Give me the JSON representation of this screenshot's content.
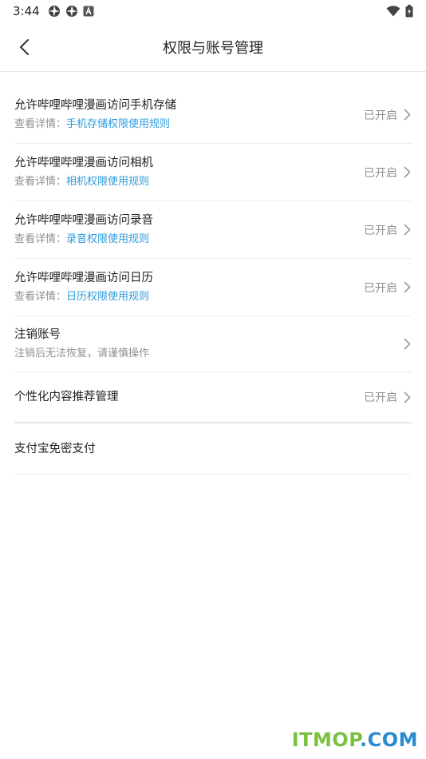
{
  "status_bar": {
    "time": "3:44",
    "left_icons": [
      "aperture-icon",
      "aperture-icon",
      "a-square-icon"
    ],
    "right_icons": [
      "wifi-icon",
      "battery-charging-icon"
    ]
  },
  "header": {
    "title": "权限与账号管理"
  },
  "rows": [
    {
      "title": "允许哔哩哔哩漫画访问手机存储",
      "sub_prefix": "查看详情：",
      "sub_link": "手机存储权限使用规则",
      "status": "已开启"
    },
    {
      "title": "允许哔哩哔哩漫画访问相机",
      "sub_prefix": "查看详情：",
      "sub_link": "相机权限使用规则",
      "status": "已开启"
    },
    {
      "title": "允许哔哩哔哩漫画访问录音",
      "sub_prefix": "查看详情：",
      "sub_link": "录音权限使用规则",
      "status": "已开启"
    },
    {
      "title": "允许哔哩哔哩漫画访问日历",
      "sub_prefix": "查看详情：",
      "sub_link": "日历权限使用规则",
      "status": "已开启"
    }
  ],
  "cancel_account": {
    "title": "注销账号",
    "sub": "注销后无法恢复，请谨慎操作"
  },
  "personalized": {
    "title": "个性化内容推荐管理",
    "status": "已开启"
  },
  "alipay": {
    "title": "支付宝免密支付"
  },
  "watermark": {
    "part1": "ITMOP",
    "part2": ".COM"
  },
  "colors": {
    "link": "#2d9bdc",
    "muted": "#8f8f8f",
    "text": "#222222"
  }
}
